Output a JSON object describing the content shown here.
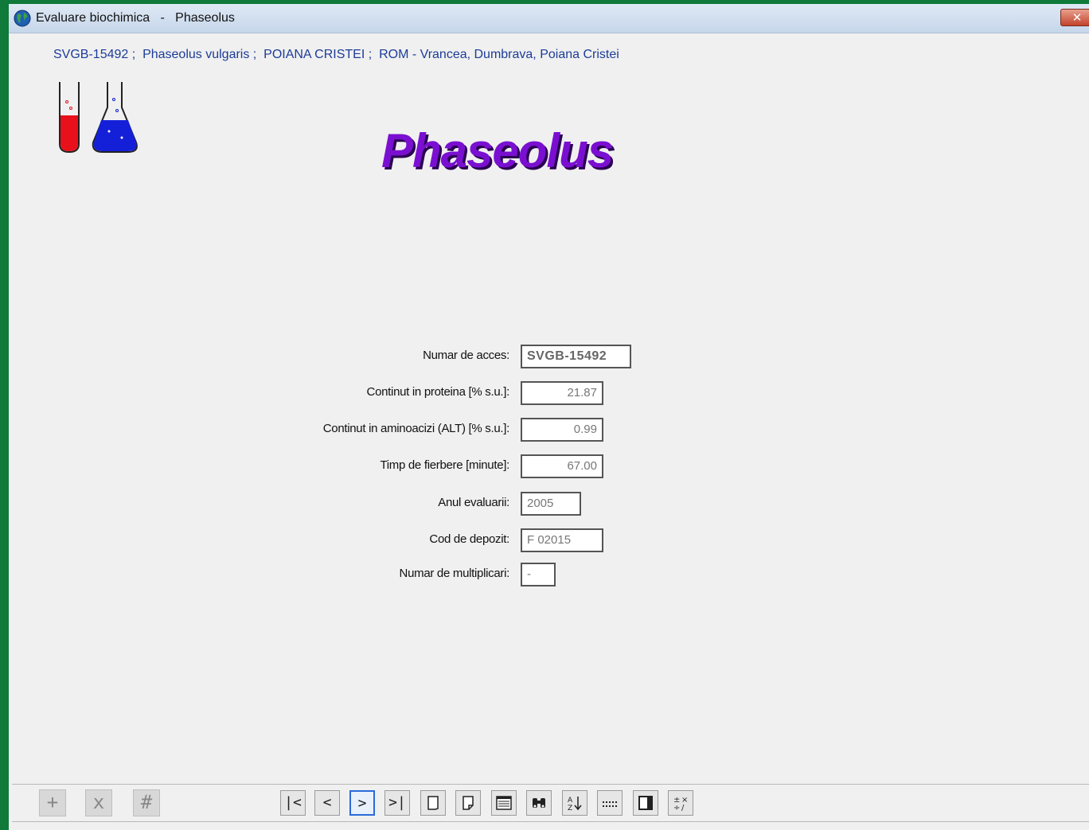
{
  "window": {
    "title": "Evaluare biochimica   -   Phaseolus",
    "close_label": "✕"
  },
  "header": {
    "info_line": "SVGB-15492 ;  Phaseolus vulgaris ;  POIANA CRISTEI ;  ROM - Vrancea, Dumbrava, Poiana Cristei",
    "title": "Phaseolus"
  },
  "form": {
    "fields": [
      {
        "label": "Numar de acces:",
        "value": "SVGB-15492"
      },
      {
        "label": "Continut in proteina [% s.u.]:",
        "value": "21.87"
      },
      {
        "label": "Continut in aminoacizi (ALT) [% s.u.]:",
        "value": "0.99"
      },
      {
        "label": "Timp de fierbere [minute]:",
        "value": "67.00"
      },
      {
        "label": "Anul evaluarii:",
        "value": "2005"
      },
      {
        "label": "Cod de depozit:",
        "value": "F 02015"
      },
      {
        "label": "Numar de multiplicari:",
        "value": "-"
      }
    ]
  },
  "toolbar": {
    "add_label": "+",
    "delete_label": "x",
    "number_label": "#",
    "first_label": "|<",
    "prev_label": "<",
    "next_label": ">",
    "last_label": ">|"
  },
  "colors": {
    "title_purple": "#7a0fd1",
    "info_blue": "#1c3c98",
    "desktop_green": "#0f7a3a"
  }
}
